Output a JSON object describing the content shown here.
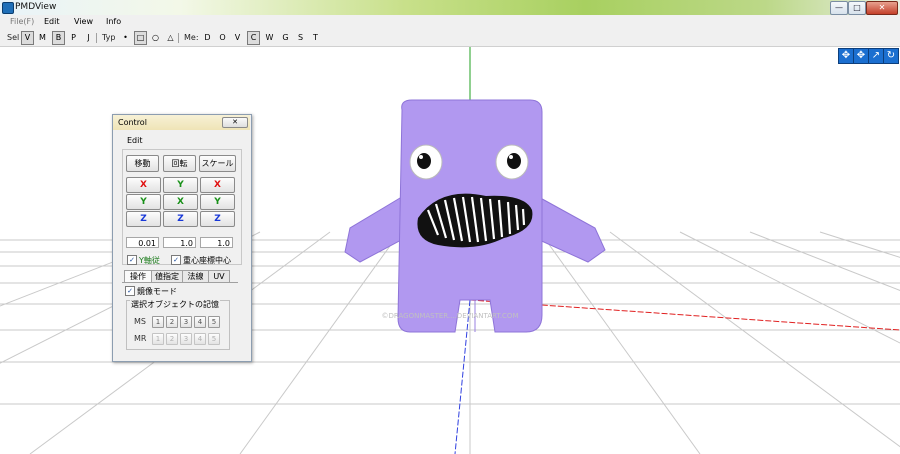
{
  "window": {
    "title": "PMDView",
    "minimize_glyph": "—",
    "maximize_glyph": "□",
    "close_glyph": "✕"
  },
  "menu": {
    "items": [
      {
        "label": "File(F)",
        "disabled": true
      },
      {
        "label": "Edit",
        "disabled": false
      },
      {
        "label": "View",
        "disabled": false
      },
      {
        "label": "Info",
        "disabled": false
      }
    ]
  },
  "toolbar": {
    "sel_label": "Sel",
    "sel_buttons": [
      "V",
      "M",
      "B",
      "P",
      "J"
    ],
    "sel_pressed": [
      "V",
      "B"
    ],
    "typ_label": "Typ",
    "typ_buttons": [
      "•",
      "□",
      "○",
      "△"
    ],
    "typ_pressed": [
      "□"
    ],
    "me_label": "Me:",
    "me_buttons": [
      "D",
      "O",
      "V",
      "C",
      "W",
      "G",
      "S",
      "T"
    ],
    "me_pressed": [
      "C"
    ]
  },
  "nav_buttons": [
    {
      "icon": "move-icon",
      "glyph": "✥"
    },
    {
      "icon": "move-alt-icon",
      "glyph": "✥"
    },
    {
      "icon": "zoom-icon",
      "glyph": "↗"
    },
    {
      "icon": "rotate-icon",
      "glyph": "↻"
    }
  ],
  "viewport": {
    "watermark": "©DRAGONMASTER....DEVIANTART.COM",
    "colors": {
      "body": "#b198f0",
      "grid": "#c8c8c8",
      "axis_red": "#e02020",
      "axis_green": "#20a020",
      "axis_blue": "#3040e0"
    }
  },
  "control": {
    "title": "Control",
    "close_glyph": "✕",
    "menu_label": "Edit",
    "mode_buttons": [
      "移動",
      "回転",
      "スケール"
    ],
    "axis_grid": [
      [
        "X",
        "Y",
        "X"
      ],
      [
        "Y",
        "X",
        "Y"
      ],
      [
        "Z",
        "Z",
        "Z"
      ]
    ],
    "values": [
      "0.01",
      "1.0",
      "1.0"
    ],
    "check_y_axis": {
      "label": "Y軸従",
      "checked": true
    },
    "check_center": {
      "label": "重心座標中心",
      "checked": true
    },
    "tabs": [
      "操作",
      "値指定",
      "法線",
      "UV"
    ],
    "active_tab": "操作",
    "check_mirror": {
      "label": "鏡像モード",
      "checked": true
    },
    "selection_memory": {
      "title": "選択オブジェクトの記憶",
      "rows": [
        {
          "label": "MS",
          "buttons": [
            "1",
            "2",
            "3",
            "4",
            "5"
          ]
        },
        {
          "label": "MR",
          "buttons": [
            "1",
            "2",
            "3",
            "4",
            "5"
          ]
        }
      ]
    }
  }
}
